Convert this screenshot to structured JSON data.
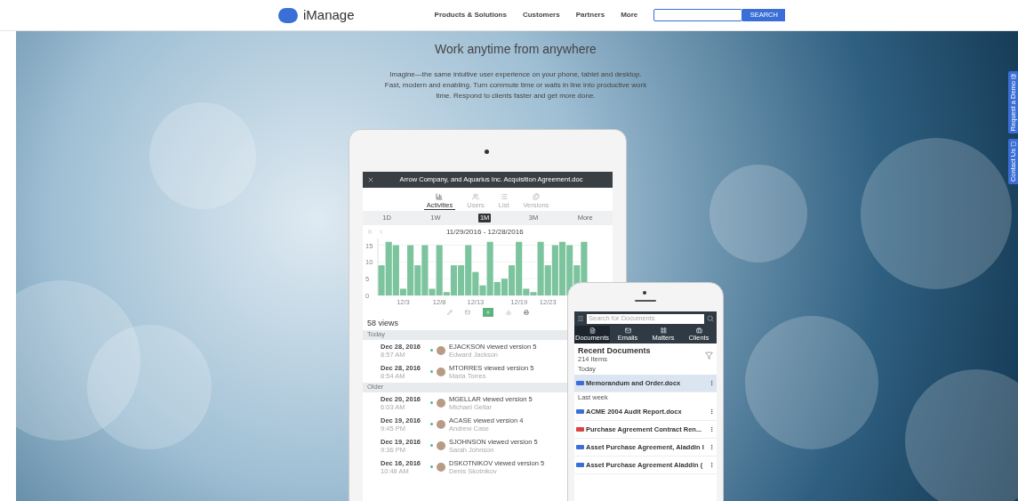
{
  "header": {
    "logo": "iManage",
    "nav": [
      "Products & Solutions",
      "Customers",
      "Partners",
      "More"
    ],
    "search": {
      "button": "SEARCH"
    }
  },
  "hero": {
    "title": "Work anytime from anywhere",
    "text": "Imagine—the same intuitive user experience on your phone, tablet and desktop. Fast, modern and enabling. Turn commute time or waits in line into productive work time. Respond to clients faster and get more done."
  },
  "side_tabs": [
    {
      "kind": "demo",
      "label": "Request a Demo"
    },
    {
      "kind": "contact",
      "label": "Contact Us"
    }
  ],
  "tablet": {
    "doc_title": "Arrow Company, and Aquarius Inc. Acquisition Agreement.doc",
    "tabs": [
      {
        "label": "Activities",
        "selected": true
      },
      {
        "label": "Users",
        "selected": false
      },
      {
        "label": "List",
        "selected": false
      },
      {
        "label": "Versions",
        "selected": false
      }
    ],
    "ranges": [
      {
        "label": "1D",
        "selected": false
      },
      {
        "label": "1W",
        "selected": false
      },
      {
        "label": "1M",
        "selected": true
      },
      {
        "label": "3M",
        "selected": false
      },
      {
        "label": "More",
        "selected": false
      }
    ],
    "date_range": "11/29/2016 - 12/28/2016",
    "chart_data": {
      "type": "bar",
      "grid": true,
      "categories": [
        null,
        null,
        null,
        "12/3",
        null,
        null,
        null,
        null,
        "12/8",
        null,
        null,
        null,
        null,
        "12/13",
        null,
        null,
        null,
        null,
        null,
        "12/19",
        null,
        null,
        null,
        "12/23",
        null,
        null,
        null,
        null,
        null
      ],
      "series": [
        {
          "color": "#7cc49d",
          "values": [
            9,
            16,
            15,
            2,
            15,
            9,
            15,
            2,
            15,
            1,
            9,
            9,
            15,
            7,
            3,
            16,
            4,
            5,
            9,
            16,
            2,
            1,
            16,
            9,
            15,
            16,
            15,
            9,
            16
          ]
        }
      ],
      "ylim": [
        0,
        17
      ],
      "yticks": [
        0,
        5,
        10,
        15
      ]
    },
    "views": "58 views",
    "groups": [
      {
        "label": "Today",
        "entries": [
          {
            "date": "Dec 28, 2016",
            "time": "8:57 AM",
            "action": "EJACKSON viewed version 5",
            "user": "Edward Jackson"
          },
          {
            "date": "Dec 28, 2016",
            "time": "8:54 AM",
            "action": "MTORRES viewed version 5",
            "user": "Maria Torres"
          }
        ]
      },
      {
        "label": "Older",
        "entries": [
          {
            "date": "Dec 20, 2016",
            "time": "6:03 AM",
            "action": "MGELLAR viewed version 5",
            "user": "Michael Gellar"
          },
          {
            "date": "Dec 19, 2016",
            "time": "9:45 PM",
            "action": "ACASE viewed version 4",
            "user": "Andrew Case"
          },
          {
            "date": "Dec 19, 2016",
            "time": "9:36 PM",
            "action": "SJOHNSON viewed version 5",
            "user": "Sarah Johnson"
          },
          {
            "date": "Dec 16, 2016",
            "time": "10:48 AM",
            "action": "DSKOTNIKOV viewed version 5",
            "user": "Denis Skotnikov"
          }
        ]
      }
    ]
  },
  "phone": {
    "search_placeholder": "Search for Documents",
    "tabs": [
      {
        "label": "Documents",
        "selected": true
      },
      {
        "label": "Emails",
        "selected": false
      },
      {
        "label": "Matters",
        "selected": false
      },
      {
        "label": "Clients",
        "selected": false
      }
    ],
    "heading": "Recent Documents",
    "count": "214 Items",
    "groups": [
      {
        "label": "Today",
        "items": [
          {
            "name": "Memorandum and Order.docx",
            "color": "#3b6fd8",
            "selected": true
          }
        ]
      },
      {
        "label": "Last week",
        "items": [
          {
            "name": "ACME 2004 Audit Report.docx",
            "color": "#3b6fd8",
            "selected": false
          },
          {
            "name": "Purchase Agreement Contract Ren...",
            "color": "#d94343",
            "selected": false
          },
          {
            "name": "Asset Purchase Agreement, Aladdin I",
            "color": "#3b6fd8",
            "selected": false
          },
          {
            "name": "Asset Purchase Agreement Aladdin (",
            "color": "#3b6fd8",
            "selected": false
          }
        ]
      }
    ]
  }
}
